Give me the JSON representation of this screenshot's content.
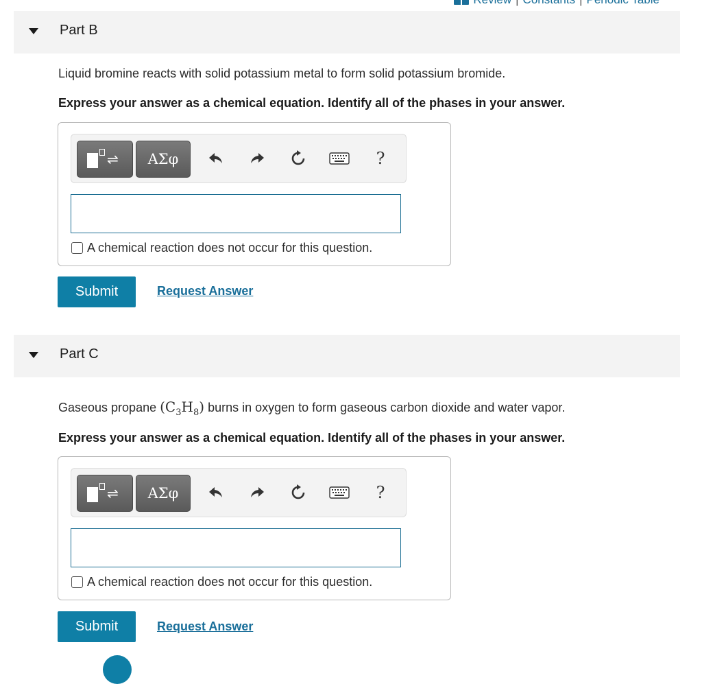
{
  "top_links": {
    "review": "Review",
    "separator": "|",
    "constants": "Constants",
    "periodic_table": "Periodic Table"
  },
  "parts": [
    {
      "title": "Part B",
      "prompt": "Liquid bromine reacts with solid potassium metal to form solid potassium bromide.",
      "instruction": "Express your answer as a chemical equation. Identify all of the phases in your answer.",
      "toolbar": {
        "templates_icon": "templates-icon",
        "greek_label": "ΑΣφ",
        "help_label": "?"
      },
      "input_value": "",
      "no_reaction_label": "A chemical reaction does not occur for this question.",
      "no_reaction_checked": false,
      "submit_label": "Submit",
      "request_label": "Request Answer"
    },
    {
      "title": "Part C",
      "prompt_before": "Gaseous propane ",
      "formula": {
        "open": "(",
        "c": "C",
        "c_sub": "3",
        "h": "H",
        "h_sub": "8",
        "close": ")"
      },
      "prompt_after": " burns in oxygen to form gaseous carbon dioxide and water vapor.",
      "instruction": "Express your answer as a chemical equation. Identify all of the phases in your answer.",
      "toolbar": {
        "templates_icon": "templates-icon",
        "greek_label": "ΑΣφ",
        "help_label": "?"
      },
      "input_value": "",
      "no_reaction_label": "A chemical reaction does not occur for this question.",
      "no_reaction_checked": false,
      "submit_label": "Submit",
      "request_label": "Request Answer"
    }
  ],
  "colors": {
    "accent": "#0f7fa6",
    "link": "#1a6f9a",
    "header_bg": "#f3f3f3"
  }
}
